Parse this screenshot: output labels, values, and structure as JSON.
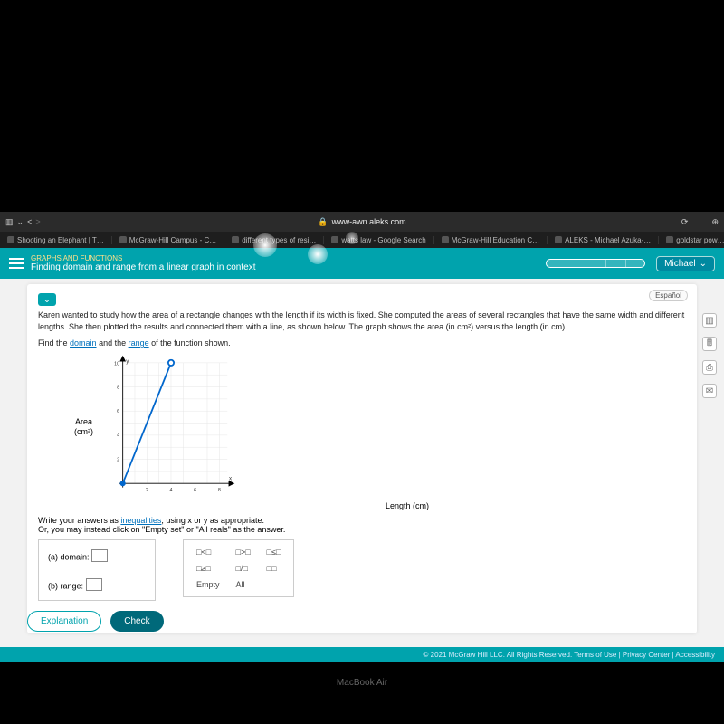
{
  "browser": {
    "url": "www-awn.aleks.com",
    "tabs": [
      "Shooting an Elephant | T…",
      "McGraw-Hill Campus - C…",
      "different types of resi…",
      "watts law - Google Search",
      "McGraw-Hill Education C…",
      "ALEKS - Michael Azuka-…",
      "goldstar pow…"
    ]
  },
  "header": {
    "category": "GRAPHS AND FUNCTIONS",
    "topic": "Finding domain and range from a linear graph in context",
    "user": "Michael",
    "espanol": "Español"
  },
  "problem": {
    "p1": "Karen wanted to study how the area of a rectangle changes with the length if its width is fixed. She computed the areas of several rectangles that have the same width and different lengths. She then plotted the results and connected them with a line, as shown below. The graph shows the area (in cm²) versus the length (in cm).",
    "p2_a": "Find the ",
    "p2_domain": "domain",
    "p2_b": " and the ",
    "p2_range": "range",
    "p2_c": " of the function shown.",
    "y_label_a": "Area",
    "y_label_b": "(cm²)",
    "x_label": "Length (cm)",
    "instr_a": "Write your answers as ",
    "instr_link": "inequalities",
    "instr_b": ", using x or y as appropriate.",
    "instr_c": "Or, you may instead click on \"Empty set\" or \"All reals\" as the answer.",
    "a_label": "(a) domain:",
    "b_label": "(b) range:"
  },
  "symbols": {
    "s1": "□<□",
    "s2": "□>□",
    "s3": "□≤□",
    "s4": "□≥□",
    "s5": "□/□",
    "s6": "□□",
    "s7": "Empty",
    "s8": "All"
  },
  "buttons": {
    "explanation": "Explanation",
    "check": "Check"
  },
  "footer": {
    "copy": "© 2021 McGraw Hill LLC. All Rights Reserved.   Terms of Use  |  Privacy Center  |  Accessibility"
  },
  "device": "MacBook Air",
  "chart_data": {
    "type": "line",
    "title": "",
    "xlabel": "Length (cm)",
    "ylabel": "Area (cm²)",
    "xlim": [
      0,
      8
    ],
    "ylim": [
      0,
      10
    ],
    "x_ticks": [
      0,
      1,
      2,
      3,
      4,
      5,
      6,
      7,
      8
    ],
    "y_ticks": [
      0,
      1,
      2,
      3,
      4,
      5,
      6,
      7,
      8,
      9,
      10
    ],
    "series": [
      {
        "name": "Area vs length",
        "x": [
          0,
          4
        ],
        "y": [
          0,
          10
        ]
      }
    ],
    "endpoints": [
      {
        "x": 0,
        "y": 0,
        "closed": true
      },
      {
        "x": 4,
        "y": 10,
        "closed": false
      }
    ]
  }
}
